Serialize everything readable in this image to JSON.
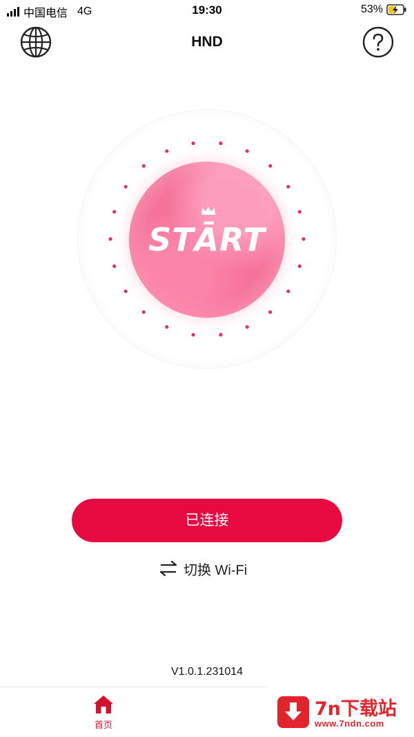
{
  "status_bar": {
    "carrier": "中国电信",
    "network": "4G",
    "time": "19:30",
    "battery_percent": "53%",
    "battery_level": 0.53,
    "charging": true
  },
  "header": {
    "title": "HND",
    "left_icon": "globe-icon",
    "right_icon": "help-icon"
  },
  "start": {
    "label": "STĀRT",
    "accent_color": "#f5739a",
    "dot_color": "#e0306a"
  },
  "connect_button": {
    "label": "已连接",
    "color": "#e60a40"
  },
  "switch_wifi": {
    "label": "切换 Wi-Fi",
    "icon": "swap-arrows-icon"
  },
  "version": "V1.0.1.231014",
  "tab_bar": {
    "items": [
      {
        "label": "首页",
        "icon": "home-icon",
        "active": true,
        "active_color": "#d4112f"
      }
    ]
  },
  "watermark": {
    "title": "7n下载站",
    "url": "www.7ndn.com",
    "color": "#e2252c"
  }
}
